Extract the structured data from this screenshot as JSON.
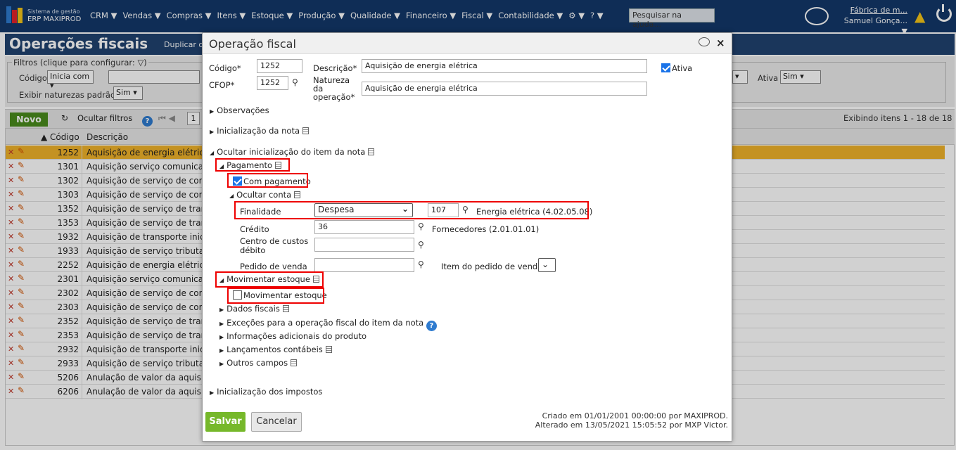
{
  "app": {
    "brand_line1": "Sistema de gestão",
    "brand_line2": "ERP MAXIPROD"
  },
  "menu": [
    "CRM ▼",
    "Vendas ▼",
    "Compras ▼",
    "Itens ▼",
    "Estoque ▼",
    "Produção ▼",
    "Qualidade ▼",
    "Financeiro ▼",
    "Fiscal ▼",
    "Contabilidade ▼",
    "⚙ ▼",
    "? ▼"
  ],
  "search_placeholder": "Pesquisar na ajuda...",
  "user": {
    "company": "Fábrica de m...",
    "name": "Samuel Gonça... ▼"
  },
  "page": {
    "title": "Operações fiscais",
    "duplicate": "Duplicar o"
  },
  "filters": {
    "legend": "Filtros (clique para configurar: ▽)",
    "codigo_label": "Código",
    "codigo_op": "Inicia com ▾",
    "natureza_label": "Exibir naturezas padrão",
    "natureza_val": "Sim ▾",
    "ativa_label": "Ativa",
    "ativa_val": "Sim ▾"
  },
  "toolbar": {
    "novo": "Novo",
    "ocultar": "Ocultar filtros",
    "page": "1",
    "exibindo": "Exibindo itens 1 - 18 de 18"
  },
  "grid": {
    "col_codigo": "▲ Código",
    "col_desc": "Descrição",
    "rows": [
      {
        "code": "1252",
        "desc": "Aquisição de energia elétrica"
      },
      {
        "code": "1301",
        "desc": "Aquisição serviço comunicação"
      },
      {
        "code": "1302",
        "desc": "Aquisição de serviço de comuni"
      },
      {
        "code": "1303",
        "desc": "Aquisição de serviço de comuni"
      },
      {
        "code": "1352",
        "desc": "Aquisição de serviço de transpo"
      },
      {
        "code": "1353",
        "desc": "Aquisição de serviço de transpo"
      },
      {
        "code": "1932",
        "desc": "Aquisição de transporte iniciad"
      },
      {
        "code": "1933",
        "desc": "Aquisição de serviço tributado"
      },
      {
        "code": "2252",
        "desc": "Aquisição de energia elétrica"
      },
      {
        "code": "2301",
        "desc": "Aquisição serviço comunicação"
      },
      {
        "code": "2302",
        "desc": "Aquisição de serviço de comuni"
      },
      {
        "code": "2303",
        "desc": "Aquisição de serviço de comuni"
      },
      {
        "code": "2352",
        "desc": "Aquisição de serviço de transpo"
      },
      {
        "code": "2353",
        "desc": "Aquisição de serviço de transpo"
      },
      {
        "code": "2932",
        "desc": "Aquisição de transporte iniciad"
      },
      {
        "code": "2933",
        "desc": "Aquisição de serviço tributado"
      },
      {
        "code": "5206",
        "desc": "Anulação de valor da aquisição"
      },
      {
        "code": "6206",
        "desc": "Anulação de valor da aquisição"
      }
    ]
  },
  "modal": {
    "title": "Operação fiscal",
    "codigo_label": "Código*",
    "codigo_val": "1252",
    "descricao_label": "Descrição*",
    "descricao_val": "Aquisição de energia elétrica",
    "ativa_label": "Ativa",
    "cfop_label": "CFOP*",
    "cfop_val": "1252",
    "natureza_label1": "Natureza",
    "natureza_label2": "da",
    "natureza_label3": "operação*",
    "natureza_val": "Aquisição de energia elétrica",
    "observacoes": "Observações",
    "init_nota": "Inicialização da nota",
    "ocultar_init_item": "Ocultar inicialização do item da nota",
    "pagamento": "Pagamento",
    "com_pagamento": "Com pagamento",
    "ocultar_conta": "Ocultar conta",
    "finalidade_label": "Finalidade",
    "finalidade_val": "Despesa",
    "conta_code": "107",
    "conta_desc": "Energia elétrica (4.02.05.08)",
    "credito_label": "Crédito",
    "credito_val": "36",
    "credito_desc": "Fornecedores (2.01.01.01)",
    "centro_label1": "Centro de custos",
    "centro_label2": "débito",
    "pedido_label": "Pedido de venda",
    "item_pedido_label": "Item do pedido de venda",
    "movimentar": "Movimentar estoque",
    "movimentar_cb": "Movimentar estoque",
    "dados_fiscais": "Dados fiscais",
    "excecoes": "Exceções para a operação fiscal do item da nota",
    "info_adicionais": "Informações adicionais do produto",
    "lancamentos": "Lançamentos contábeis",
    "outros": "Outros campos",
    "init_impostos": "Inicialização dos impostos",
    "salvar": "Salvar",
    "cancelar": "Cancelar",
    "criado": "Criado em 01/01/2001 00:00:00 por MAXIPROD.",
    "alterado": "Alterado em 13/05/2021 15:05:52 por MXP Victor."
  },
  "colors": {
    "topbar": "#13386a",
    "accent_red": "#e00000",
    "save_green": "#76b82a"
  }
}
